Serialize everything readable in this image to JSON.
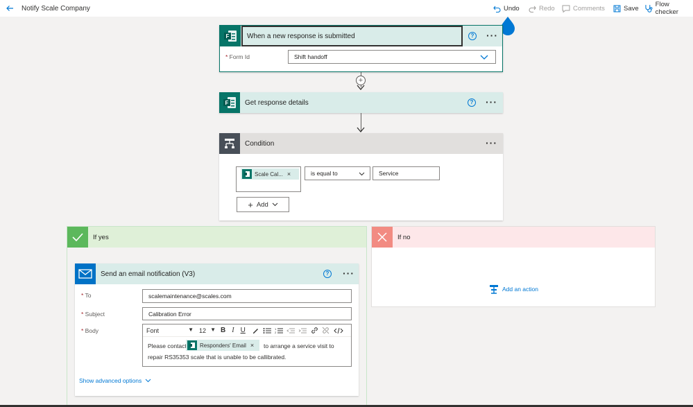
{
  "app": {
    "flow_title": "Notify Scale Company",
    "back_icon": "back-arrow-icon"
  },
  "toolbar": {
    "undo": "Undo",
    "redo": "Redo",
    "comments": "Comments",
    "save": "Save",
    "flow_checker": "Flow checker"
  },
  "trigger": {
    "title": "When a new response is submitted",
    "form_id_label": "Form Id",
    "form_id_value": "Shift handoff",
    "help": "?"
  },
  "get_response": {
    "title": "Get response details",
    "help": "?"
  },
  "condition": {
    "title": "Condition",
    "chip_label": "Scale Cal...",
    "operator": "is equal to",
    "value": "Service",
    "add_label": "Add"
  },
  "if_yes": {
    "title": "If yes"
  },
  "if_no": {
    "title": "If no",
    "add_action": "Add an action"
  },
  "email": {
    "title": "Send an email notification (V3)",
    "help": "?",
    "to_label": "To",
    "to_value": "scalemaintenance@scales.com",
    "subject_label": "Subject",
    "subject_value": "Calibration Error",
    "body_label": "Body",
    "font_label": "Font",
    "font_size": "12",
    "body_prefix": "Please contact",
    "body_chip": "Responders' Email",
    "body_suffix": "to arrange a service visit to",
    "body_line2": "repair RS35353 scale that is unable to be callibrated.",
    "show_advanced": "Show advanced options"
  },
  "colors": {
    "forms_green": "#077568",
    "condition_gray": "#484f58",
    "yes_green": "#5cb85c",
    "no_red": "#f28b82",
    "outlook_blue": "#0072c6",
    "accent": "#0078d4"
  }
}
